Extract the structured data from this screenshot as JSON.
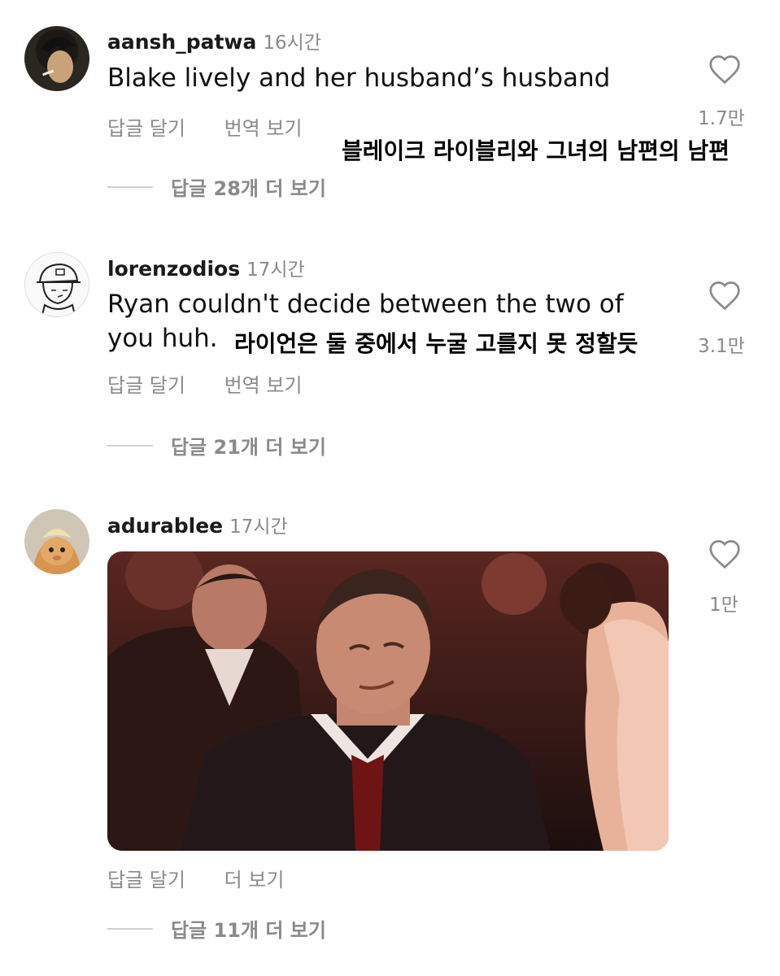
{
  "comments": [
    {
      "username": "aansh_patwa",
      "time": "16시간",
      "text": "Blake lively and her husband’s husband",
      "reply_label": "답글 달기",
      "translate_label": "번역 보기",
      "likes": "1.7만",
      "replies_label": "답글 28개 더 보기",
      "overlay": "블레이크 라이블리와 그녀의 남편의 남편"
    },
    {
      "username": "lorenzodios",
      "time": "17시간",
      "text_line1": "Ryan couldn't decide between the two of",
      "text_line2": "you huh.",
      "reply_label": "답글 달기",
      "translate_label": "번역 보기",
      "likes": "3.1만",
      "replies_label": "답글 21개 더 보기",
      "overlay": "라이언은 둘 중에서 누굴 고를지 못 정할듯"
    },
    {
      "username": "adurablee",
      "time": "17시간",
      "reply_label": "답글 달기",
      "more_label": "더 보기",
      "likes": "1만",
      "replies_label": "답글 11개 더 보기"
    }
  ],
  "icons": {
    "heart": "heart-icon"
  },
  "colors": {
    "muted": "#8a8a8a",
    "text": "#111111"
  }
}
